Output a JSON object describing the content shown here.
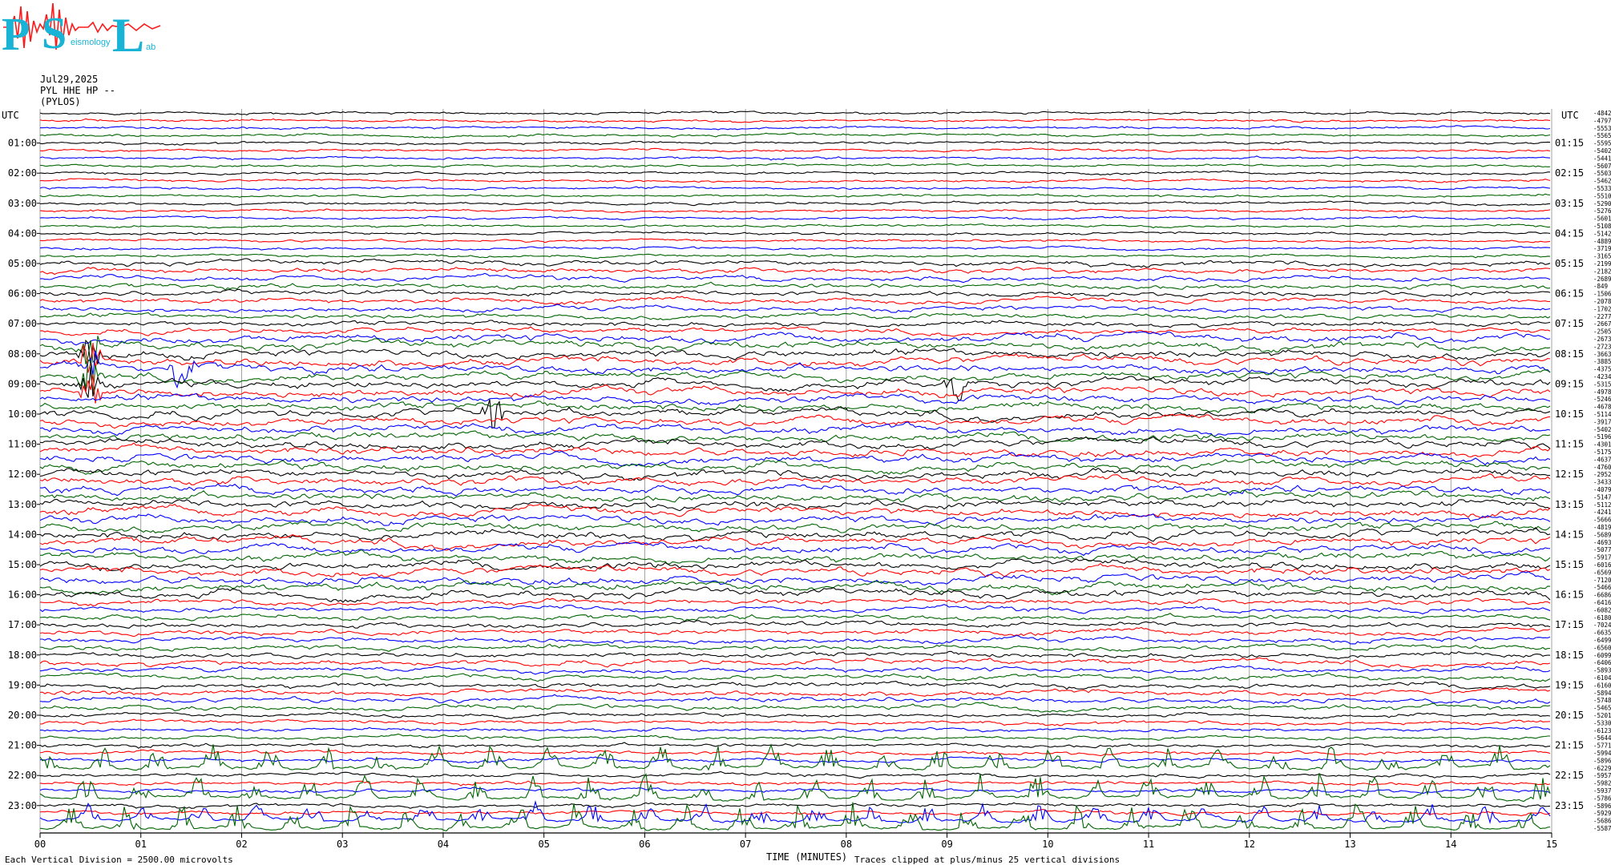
{
  "header": {
    "date": "Jul29,2025",
    "station": "PYL HHE HP --",
    "location": "(PYLOS)"
  },
  "logo": {
    "letters": [
      "P",
      "S",
      "L"
    ],
    "small_words": [
      "",
      "eismology",
      "ab"
    ]
  },
  "footer": {
    "scale": "Each Vertical Division = 2500.00 microvolts",
    "axis_title": "TIME (MINUTES)",
    "clip_note": "Traces clipped at plus/minus 25 vertical divisions"
  },
  "chart_data": {
    "type": "line",
    "title": "",
    "xlabel": "TIME (MINUTES)",
    "xlim": [
      0,
      15
    ],
    "x_ticks": [
      "00",
      "01",
      "02",
      "03",
      "04",
      "05",
      "06",
      "07",
      "08",
      "09",
      "10",
      "11",
      "12",
      "13",
      "14",
      "15"
    ],
    "left_axis_label": "UTC",
    "right_axis_label": "UTC",
    "left_hour_labels": [
      "01:00",
      "02:00",
      "03:00",
      "04:00",
      "05:00",
      "06:00",
      "07:00",
      "08:00",
      "09:00",
      "10:00",
      "11:00",
      "12:00",
      "13:00",
      "14:00",
      "15:00",
      "16:00",
      "17:00",
      "18:00",
      "19:00",
      "20:00",
      "21:00",
      "22:00",
      "23:00"
    ],
    "right_hour_labels": [
      "01:15",
      "02:15",
      "03:15",
      "04:15",
      "05:15",
      "06:15",
      "07:15",
      "08:15",
      "09:15",
      "10:15",
      "11:15",
      "12:15",
      "13:15",
      "14:15",
      "15:15",
      "16:15",
      "17:15",
      "18:15",
      "19:15",
      "20:15",
      "21:15",
      "22:15",
      "23:15"
    ],
    "trace_color_cycle": [
      "#000000",
      "#ff0000",
      "#0000ff",
      "#006400"
    ],
    "trace_count": 96,
    "minutes_per_trace": 15,
    "scale_microvolts_per_division": 2500.0,
    "clip_divisions": 25,
    "trace_offsets": [
      -4842,
      -4797,
      -5553,
      -5565,
      -5595,
      -5402,
      -5441,
      -5607,
      -5503,
      -5462,
      -5533,
      -5510,
      -5290,
      -5276,
      -5601,
      -5108,
      -5142,
      -4889,
      -3719,
      -3165,
      -2199,
      -2182,
      -2689,
      -849,
      -1506,
      -2078,
      -1702,
      -2277,
      -2667,
      -2505,
      -2673,
      -2723,
      -3663,
      -3885,
      -4375,
      -4234,
      -5315,
      -4978,
      -5246,
      -4678,
      -5114,
      -3917,
      -5402,
      -5196,
      -4301,
      -5175,
      -4637,
      -4760,
      -2952,
      -3433,
      -4079,
      -5147,
      -5112,
      -4241,
      -5666,
      -4819,
      -5689,
      -4693,
      -5077,
      -5917,
      -6016,
      -6569,
      -7120,
      -5466,
      -6686,
      -6416,
      -6082,
      -6180,
      -7024,
      -6635,
      -6499,
      -6560,
      -6099,
      -6406,
      -5893,
      -6104,
      -6160,
      -5894,
      -5748,
      -5465,
      -5201,
      -5330,
      -6123,
      -5644,
      -5771,
      -5994,
      -5896,
      -6229,
      -5957,
      -5982,
      -5937,
      -5786,
      -5896,
      -5929,
      -5686,
      -5587
    ],
    "events": [
      {
        "trace": 31,
        "minute": 0.5
      },
      {
        "trace": 32,
        "minute": 0.5
      },
      {
        "trace": 33,
        "minute": 0.5
      },
      {
        "trace": 34,
        "minute": 0.5
      },
      {
        "trace": 34,
        "minute": 1.4
      },
      {
        "trace": 35,
        "minute": 0.5
      },
      {
        "trace": 36,
        "minute": 0.5
      },
      {
        "trace": 37,
        "minute": 0.5
      },
      {
        "trace": 36,
        "minute": 9.1
      },
      {
        "trace": 40,
        "minute": 4.5
      }
    ]
  }
}
